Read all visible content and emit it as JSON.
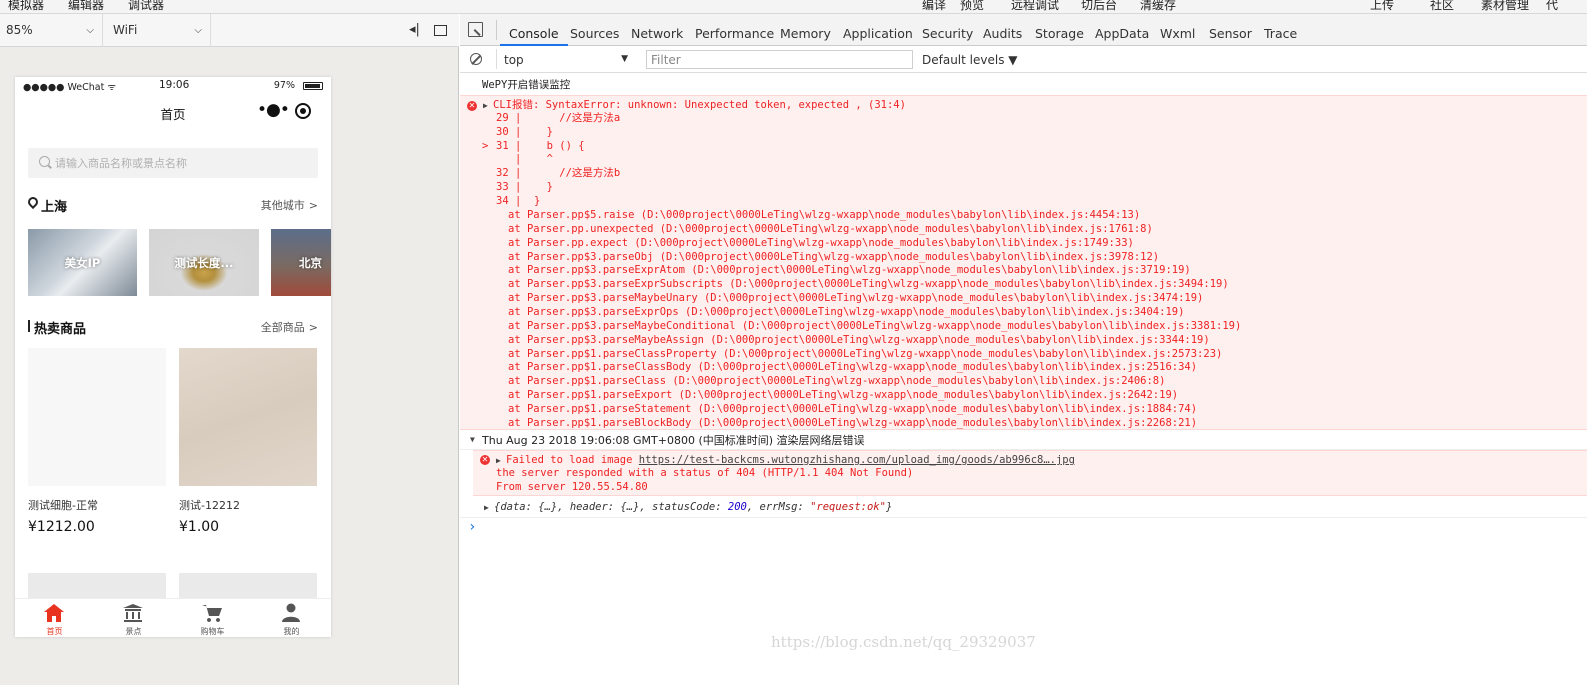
{
  "menu": {
    "items": [
      "模拟器",
      "编辑器",
      "调试器",
      "编译",
      "预览",
      "远程调试",
      "切后台",
      "清缓存",
      "上传",
      "社区",
      "素材管理",
      "代"
    ]
  },
  "device": {
    "zoom": "85%",
    "network": "WiFi"
  },
  "phone": {
    "status": {
      "carrier": "●●●●● WeChat ᯤ",
      "time": "19:06",
      "battery_text": "97%",
      "battery_level": 0.97
    },
    "nav_title": "首页",
    "nav_dots": "•●•",
    "search_placeholder": "请输入商品名称或景点名称",
    "city": "上海",
    "other_cities": "其他城市",
    "chevron": ">",
    "tiles": [
      "美女IP",
      "测试长度...",
      "北京"
    ],
    "hot_title": "热卖商品",
    "all_goods": "全部商品",
    "products": [
      {
        "name": "测试细胞-正常",
        "price": "¥1212.00"
      },
      {
        "name": "测试-12212",
        "price": "¥1.00"
      }
    ],
    "tabs": [
      {
        "label": "首页",
        "active": true
      },
      {
        "label": "景点",
        "active": false
      },
      {
        "label": "购物车",
        "active": false
      },
      {
        "label": "我的",
        "active": false
      }
    ],
    "colors": {
      "active_tab": "#e8331e",
      "inactive_tab": "#555555"
    }
  },
  "devtools": {
    "tabs": [
      "Console",
      "Sources",
      "Network",
      "Performance",
      "Memory",
      "Application",
      "Security",
      "Audits",
      "Storage",
      "AppData",
      "Wxml",
      "Sensor",
      "Trace"
    ],
    "active_tab": "Console",
    "context": "top",
    "filter_placeholder": "Filter",
    "levels": "Default levels ▼",
    "console": {
      "log1": "WePY开启错误监控",
      "err_head": "CLI报错: SyntaxError: unknown: Unexpected token, expected , (31:4)",
      "code": [
        {
          "n": "29",
          "m": " |",
          "t": "      //这是方法a"
        },
        {
          "n": "30",
          "m": " |",
          "t": "    }"
        },
        {
          "n": "31",
          "m": " |",
          "t": "    b () {",
          "mark": ">"
        },
        {
          "n": "  ",
          "m": " |",
          "t": "    ^"
        },
        {
          "n": "32",
          "m": " |",
          "t": "      //这是方法b"
        },
        {
          "n": "33",
          "m": " |",
          "t": "    }"
        },
        {
          "n": "34",
          "m": " |",
          "t": "  }"
        }
      ],
      "stack": [
        "at Parser.pp$5.raise (D:\\000project\\0000LeTing\\wlzg-wxapp\\node_modules\\babylon\\lib\\index.js:4454:13)",
        "at Parser.pp.unexpected (D:\\000project\\0000LeTing\\wlzg-wxapp\\node_modules\\babylon\\lib\\index.js:1761:8)",
        "at Parser.pp.expect (D:\\000project\\0000LeTing\\wlzg-wxapp\\node_modules\\babylon\\lib\\index.js:1749:33)",
        "at Parser.pp$3.parseObj (D:\\000project\\0000LeTing\\wlzg-wxapp\\node_modules\\babylon\\lib\\index.js:3978:12)",
        "at Parser.pp$3.parseExprAtom (D:\\000project\\0000LeTing\\wlzg-wxapp\\node_modules\\babylon\\lib\\index.js:3719:19)",
        "at Parser.pp$3.parseExprSubscripts (D:\\000project\\0000LeTing\\wlzg-wxapp\\node_modules\\babylon\\lib\\index.js:3494:19)",
        "at Parser.pp$3.parseMaybeUnary (D:\\000project\\0000LeTing\\wlzg-wxapp\\node_modules\\babylon\\lib\\index.js:3474:19)",
        "at Parser.pp$3.parseExprOps (D:\\000project\\0000LeTing\\wlzg-wxapp\\node_modules\\babylon\\lib\\index.js:3404:19)",
        "at Parser.pp$3.parseMaybeConditional (D:\\000project\\0000LeTing\\wlzg-wxapp\\node_modules\\babylon\\lib\\index.js:3381:19)",
        "at Parser.pp$3.parseMaybeAssign (D:\\000project\\0000LeTing\\wlzg-wxapp\\node_modules\\babylon\\lib\\index.js:3344:19)",
        "at Parser.pp$1.parseClassProperty (D:\\000project\\0000LeTing\\wlzg-wxapp\\node_modules\\babylon\\lib\\index.js:2573:23)",
        "at Parser.pp$1.parseClassBody (D:\\000project\\0000LeTing\\wlzg-wxapp\\node_modules\\babylon\\lib\\index.js:2516:34)",
        "at Parser.pp$1.parseClass (D:\\000project\\0000LeTing\\wlzg-wxapp\\node_modules\\babylon\\lib\\index.js:2406:8)",
        "at Parser.pp$1.parseExport (D:\\000project\\0000LeTing\\wlzg-wxapp\\node_modules\\babylon\\lib\\index.js:2642:19)",
        "at Parser.pp$1.parseStatement (D:\\000project\\0000LeTing\\wlzg-wxapp\\node_modules\\babylon\\lib\\index.js:1884:74)",
        "at Parser.pp$1.parseBlockBody (D:\\000project\\0000LeTing\\wlzg-wxapp\\node_modules\\babylon\\lib\\index.js:2268:21)"
      ],
      "group": "Thu Aug 23 2018 19:06:08 GMT+0800 (中国标准时间) 渲染层网络层错误",
      "img_err_prefix": "Failed to load image ",
      "img_err_url": "https://test-backcms.wutongzhishang.com/upload_img/goods/ab996c8….jpg",
      "img_err_2": "the server responded with a status of 404 (HTTP/1.1 404 Not Found)",
      "img_err_3": "From server 120.55.54.80",
      "obj_a": "{data: {…}, header: {…}, statusCode: ",
      "obj_status": "200",
      "obj_b": ", errMsg: ",
      "obj_msg": "\"request:ok\"",
      "obj_c": "}",
      "prompt": "›"
    }
  },
  "watermark": "https://blog.csdn.net/qq_29329037"
}
